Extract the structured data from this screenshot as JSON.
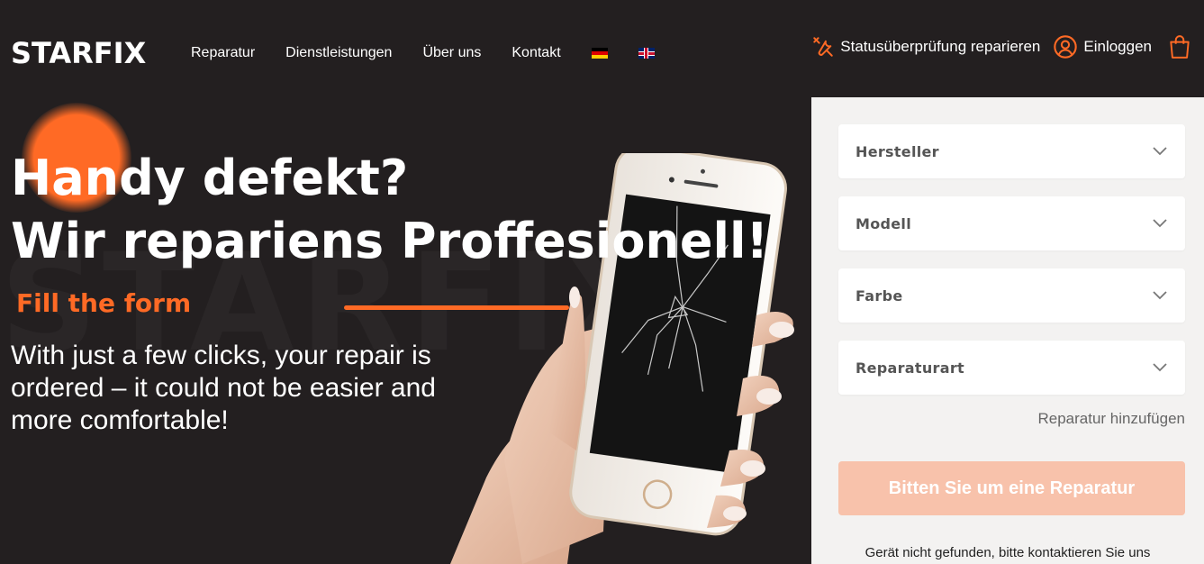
{
  "header": {
    "logo": "STARFIX",
    "nav": [
      "Reparatur",
      "Dienstleistungen",
      "Über uns",
      "Kontakt"
    ],
    "flags": [
      "flag-de-icon",
      "flag-en-icon"
    ],
    "status_link": "Statusüberprüfung reparieren",
    "login_link": "Einloggen"
  },
  "hero": {
    "watermark": "STARFIX",
    "headline_line1": "Handy defekt?",
    "headline_line2": "Wir repariens Proffesionell!",
    "fill_form": "Fill the form",
    "subtext": "With just a few clicks, your repair is ordered – it could not be easier and more comfortable!"
  },
  "form": {
    "selects": [
      "Hersteller",
      "Modell",
      "Farbe",
      "Reparaturart"
    ],
    "add_repair": "Reparatur hinzufügen",
    "request_button": "Bitten Sie um eine Reparatur",
    "not_found": "Gerät nicht gefunden, bitte kontaktieren Sie uns"
  },
  "colors": {
    "accent": "#ff6a25",
    "background": "#231f20",
    "panel": "#f3f2f1",
    "button_disabled": "#f8c2ab"
  }
}
